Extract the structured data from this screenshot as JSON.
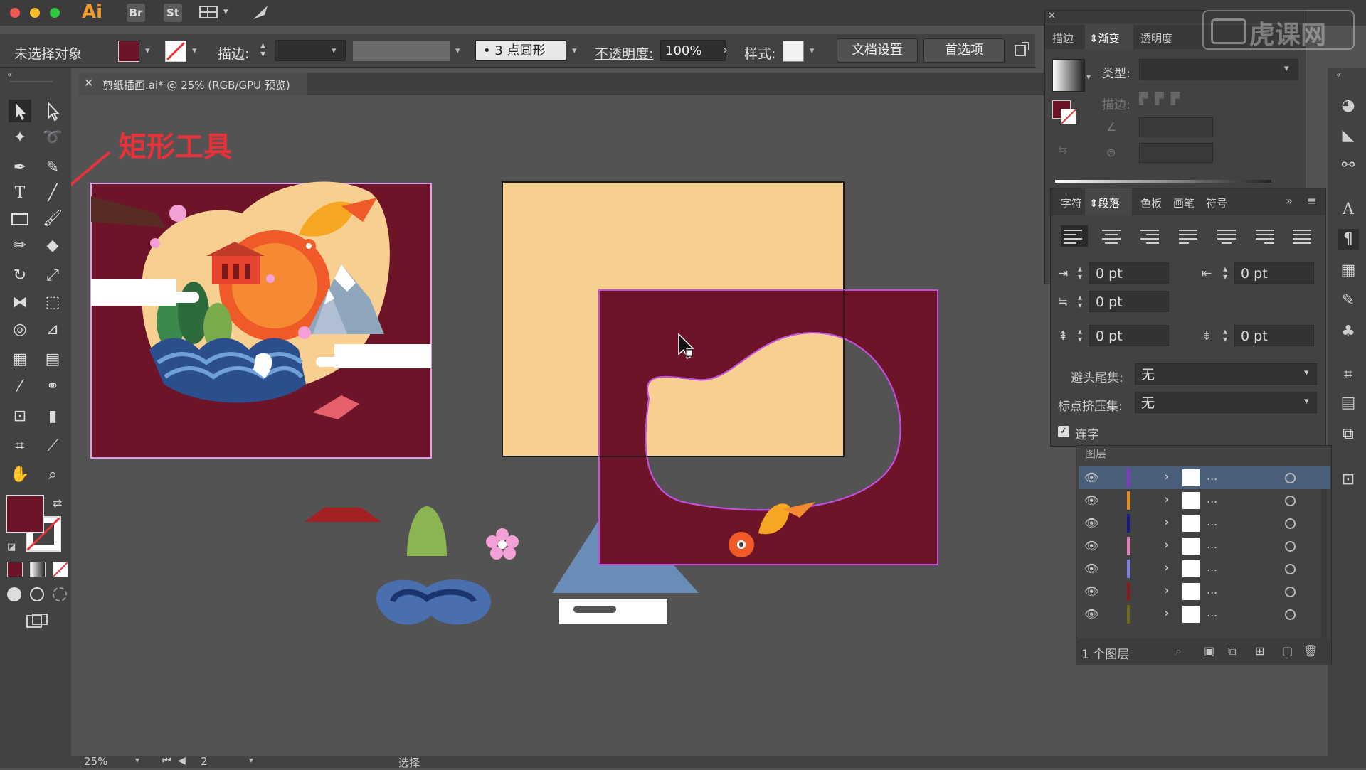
{
  "app": {
    "logo": "Ai",
    "bridge": "Br",
    "stock": "St"
  },
  "control_bar": {
    "selection": "未选择对象",
    "stroke_label": "描边:",
    "brush": "• 3 点圆形",
    "opacity_label": "不透明度:",
    "opacity_value": "100%",
    "style_label": "样式:",
    "doc_setup": "文档设置",
    "preferences": "首选项"
  },
  "document": {
    "tab_title": "剪纸插画.ai* @ 25% (RGB/GPU 预览)"
  },
  "annotation": {
    "text": "矩形工具"
  },
  "gradient_panel": {
    "tabs": [
      "描边",
      "渐变",
      "透明度"
    ],
    "type_label": "类型:",
    "stroke_label": "描边:"
  },
  "paragraph_panel": {
    "tabs": [
      "字符",
      "段落",
      "色板",
      "画笔",
      "符号"
    ],
    "fields": [
      "0 pt",
      "0 pt",
      "0 pt",
      "0 pt",
      "0 pt"
    ],
    "kinsoku_label": "避头尾集:",
    "kinsoku_value": "无",
    "mojikumi_label": "标点挤压集:",
    "mojikumi_value": "无",
    "hyphenate_label": "连字"
  },
  "layers_panel": {
    "title": "图层",
    "footer": "1 个图层",
    "rows": [
      {
        "name": "...",
        "color": "#8a35c9",
        "selected": true
      },
      {
        "name": "...",
        "color": "#e68a1c",
        "selected": false
      },
      {
        "name": "...",
        "color": "#1a1a8a",
        "selected": false
      },
      {
        "name": "...",
        "color": "#e67fb8",
        "selected": false
      },
      {
        "name": "...",
        "color": "#7f7fe6",
        "selected": false
      },
      {
        "name": "...",
        "color": "#8a1a1a",
        "selected": false
      },
      {
        "name": "...",
        "color": "#6a6a1a",
        "selected": false
      }
    ]
  },
  "status_bar": {
    "zoom": "25%",
    "page": "2",
    "mode": "选择"
  },
  "watermark": "虎课网",
  "colors": {
    "burgundy": "#6e1429",
    "cream": "#f7cf90",
    "accent_red": "#e8323a"
  }
}
